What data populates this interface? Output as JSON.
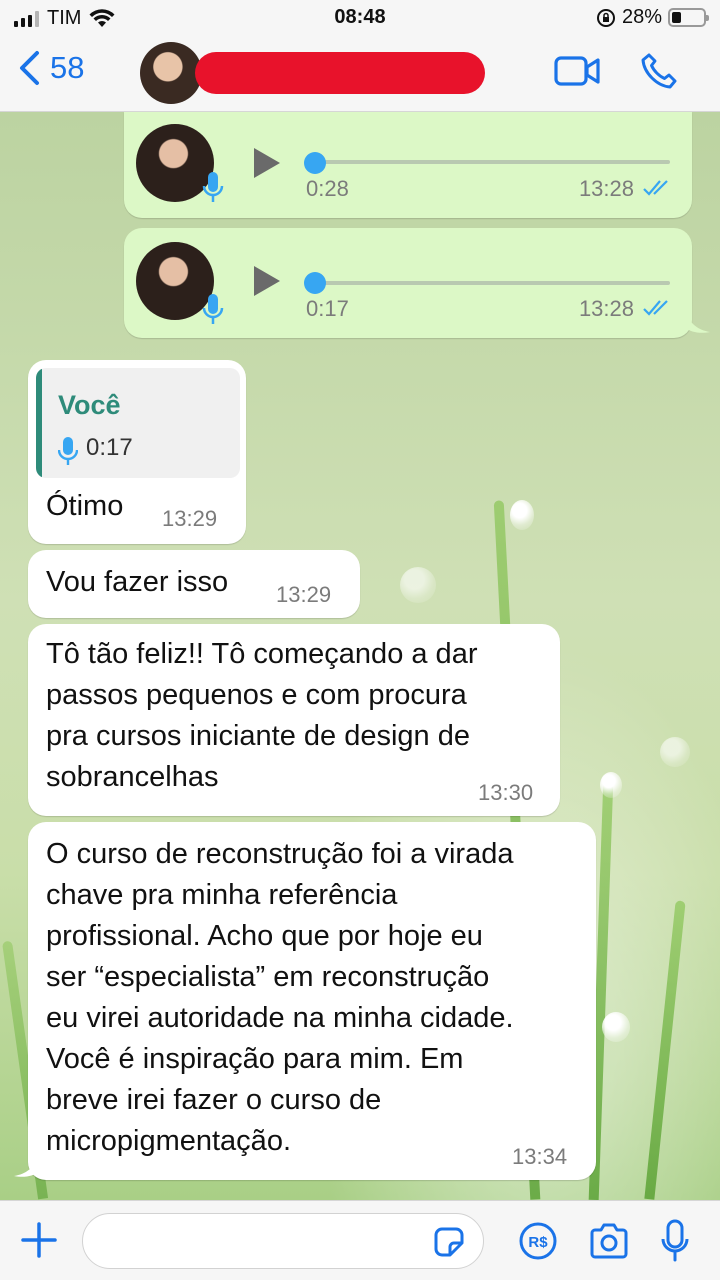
{
  "status_bar": {
    "carrier": "TIM",
    "time": "08:48",
    "battery": "28%"
  },
  "header": {
    "back_count": "58",
    "icons": [
      "chevron-left-icon",
      "video-call-icon",
      "phone-call-icon"
    ]
  },
  "messages": [
    {
      "type": "voice",
      "direction": "outgoing",
      "duration": "0:28",
      "time": "13:28",
      "status": "read"
    },
    {
      "type": "voice",
      "direction": "outgoing",
      "duration": "0:17",
      "time": "13:28",
      "status": "read"
    },
    {
      "type": "reply",
      "direction": "incoming",
      "quote_author": "Você",
      "quote_duration": "0:17",
      "text": "Ótimo",
      "time": "13:29"
    },
    {
      "type": "text",
      "direction": "incoming",
      "text": "Vou fazer isso",
      "time": "13:29"
    },
    {
      "type": "text",
      "direction": "incoming",
      "lines": [
        "Tô tão feliz!! Tô começando a dar",
        "passos pequenos e com procura",
        "pra cursos iniciante de design de",
        "sobrancelhas"
      ],
      "time": "13:30"
    },
    {
      "type": "text",
      "direction": "incoming",
      "lines": [
        "O curso de reconstrução foi a virada",
        "chave pra minha referência",
        "profissional. Acho que por hoje eu",
        "ser “especialista” em reconstrução",
        "eu virei autoridade na minha cidade.",
        "Você é inspiração para mim. Em",
        "breve irei fazer o curso de",
        "micropigmentação."
      ],
      "time": "13:34"
    }
  ],
  "input_bar": {
    "icons": [
      "plus-icon",
      "sticker-icon",
      "payment-icon",
      "camera-icon",
      "microphone-icon"
    ],
    "value": ""
  },
  "colors": {
    "accent": "#1a73e8",
    "outgoing_bubble": "#dcf8c6",
    "incoming_bubble": "#ffffff",
    "read_ticks": "#37a6f2",
    "quote_accent": "#2e8b7a",
    "redaction": "#e8122b"
  }
}
